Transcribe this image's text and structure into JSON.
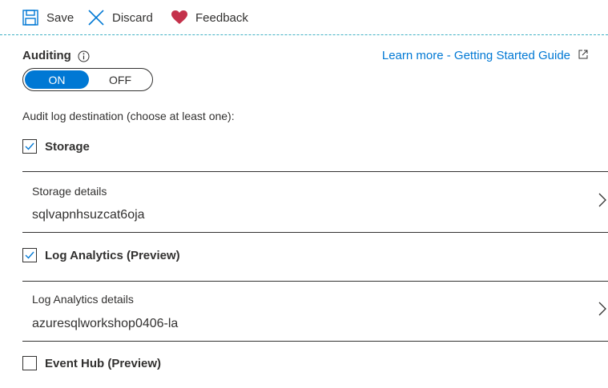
{
  "toolbar": {
    "save_label": "Save",
    "discard_label": "Discard",
    "feedback_label": "Feedback"
  },
  "auditing": {
    "label": "Auditing",
    "toggle_on": "ON",
    "toggle_off": "OFF",
    "state": "ON"
  },
  "learn_more": "Learn more - Getting Started Guide",
  "destination": {
    "label": "Audit log destination (choose at least one):",
    "storage": {
      "label": "Storage",
      "checked": true,
      "details_title": "Storage details",
      "details_value": "sqlvapnhsuzcat6oja"
    },
    "log_analytics": {
      "label": "Log Analytics (Preview)",
      "checked": true,
      "details_title": "Log Analytics details",
      "details_value": "azuresqlworkshop0406-la"
    },
    "event_hub": {
      "label": "Event Hub (Preview)",
      "checked": false
    }
  },
  "colors": {
    "accent": "#0078d4",
    "heart": "#c4314b",
    "divider": "#3fb0c4",
    "text": "#323130"
  }
}
